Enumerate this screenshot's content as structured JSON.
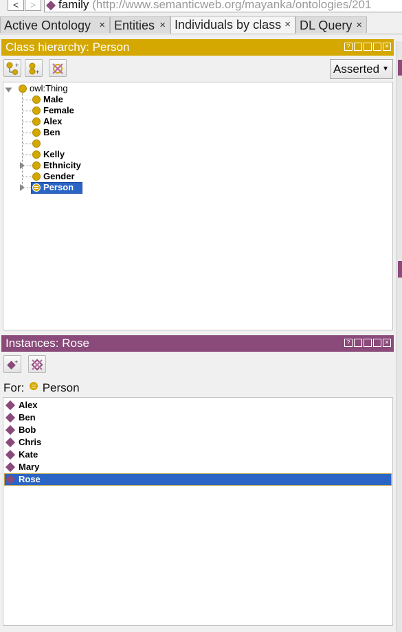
{
  "nav": {
    "back": "<",
    "forward": ">"
  },
  "address": {
    "ontology_name": "family",
    "iri": "(http://www.semanticweb.org/mayanka/ontologies/201"
  },
  "tabs": [
    {
      "label": "Active Ontology",
      "close": "×"
    },
    {
      "label": "Entities",
      "close": "×"
    },
    {
      "label": "Individuals by class",
      "close": "×"
    },
    {
      "label": "DL Query",
      "close": "×"
    }
  ],
  "class_panel": {
    "title": "Class hierarchy: Person",
    "view_mode": "Asserted",
    "root": "owl:Thing",
    "items": [
      {
        "label": "Male"
      },
      {
        "label": "Female"
      },
      {
        "label": "Alex"
      },
      {
        "label": "Ben"
      },
      {
        "label": ""
      },
      {
        "label": "Kelly"
      },
      {
        "label": "Ethnicity"
      },
      {
        "label": "Gender"
      },
      {
        "label": "Person"
      }
    ],
    "selected": "Person"
  },
  "instances_panel": {
    "title": "Instances: Rose",
    "for_label": "For:",
    "for_class": "Person",
    "items": [
      {
        "label": "Alex"
      },
      {
        "label": "Ben"
      },
      {
        "label": "Bob"
      },
      {
        "label": "Chris"
      },
      {
        "label": "Kate"
      },
      {
        "label": "Mary"
      },
      {
        "label": "Rose"
      }
    ],
    "selected": "Rose"
  },
  "colors": {
    "class_accent": "#d4a800",
    "individual_accent": "#8a4a7a",
    "selection": "#2a64c5"
  }
}
